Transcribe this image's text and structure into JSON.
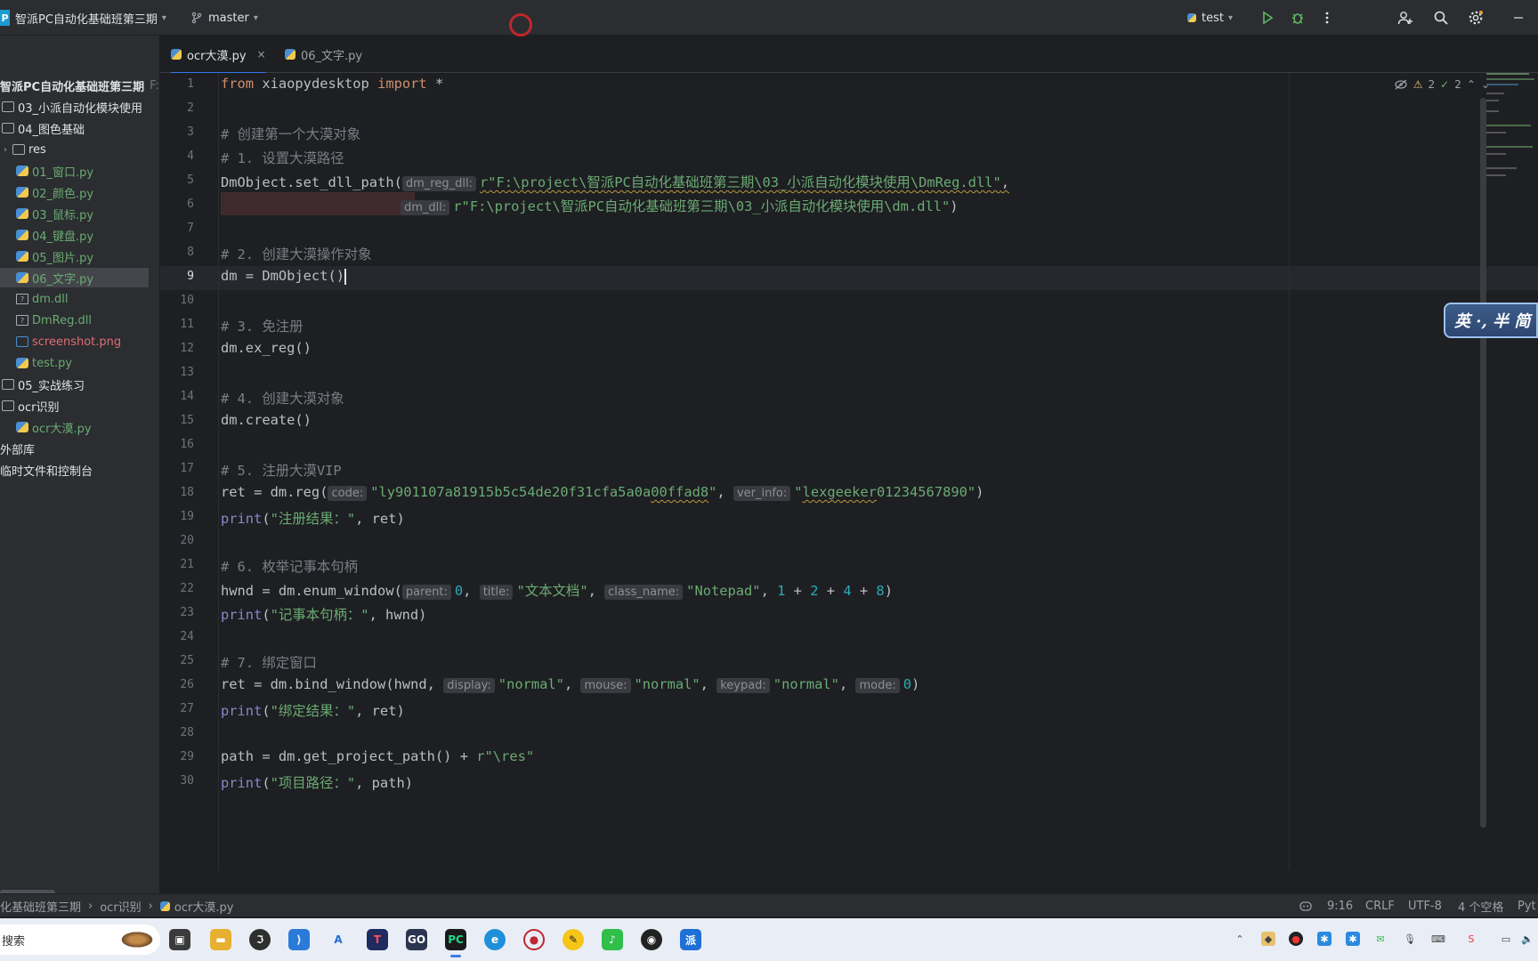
{
  "titlebar": {
    "app_badge": "P",
    "project": "智派PC自动化基础班第三期",
    "branch": "master",
    "run_config": "test"
  },
  "sidebar": {
    "items": [
      {
        "label": "智派PC自动化基础班第三期",
        "suffix": "F:\\",
        "kind": "root"
      },
      {
        "label": "03_小派自动化模块使用",
        "kind": "folder"
      },
      {
        "label": "04_图色基础",
        "kind": "folder"
      },
      {
        "label": "res",
        "kind": "folder-sub"
      },
      {
        "label": "01_窗口.py",
        "kind": "py"
      },
      {
        "label": "02_颜色.py",
        "kind": "py"
      },
      {
        "label": "03_鼠标.py",
        "kind": "py"
      },
      {
        "label": "04_键盘.py",
        "kind": "py"
      },
      {
        "label": "05_图片.py",
        "kind": "py"
      },
      {
        "label": "06_文字.py",
        "kind": "py-selected"
      },
      {
        "label": "dm.dll",
        "kind": "dll"
      },
      {
        "label": "DmReg.dll",
        "kind": "dll"
      },
      {
        "label": "screenshot.png",
        "kind": "png"
      },
      {
        "label": "test.py",
        "kind": "py"
      },
      {
        "label": "05_实战练习",
        "kind": "folder"
      },
      {
        "label": "ocr识别",
        "kind": "folder"
      },
      {
        "label": "ocr大漠.py",
        "kind": "py"
      },
      {
        "label": "外部库",
        "kind": "lib"
      },
      {
        "label": "临时文件和控制台",
        "kind": "lib"
      }
    ]
  },
  "tabs": [
    {
      "label": "ocr大漠.py",
      "active": true,
      "close": "×"
    },
    {
      "label": "06_文字.py",
      "active": false
    }
  ],
  "inspections": {
    "warnings": "2",
    "ok": "2"
  },
  "code": {
    "line_numbers": [
      "1",
      "2",
      "3",
      "4",
      "5",
      "6",
      "7",
      "8",
      "9",
      "10",
      "11",
      "12",
      "13",
      "14",
      "15",
      "16",
      "17",
      "18",
      "19",
      "20",
      "21",
      "22",
      "23",
      "24",
      "25",
      "26",
      "27",
      "28",
      "29",
      "30"
    ],
    "current_line": 9,
    "l1_kw1": "from",
    "l1_mod": " xiaopydesktop ",
    "l1_kw2": "import",
    "l1_rest": " *",
    "l3": "# 创建第一个大漠对象",
    "l4": "# 1. 设置大漠路径",
    "l5_code": "DmObject.set_dll_path(",
    "l5_hint": "dm_reg_dll:",
    "l5_str": "r\"F:\\project\\智派PC自动化基础班第三期\\03_小派自动化模块使用\\DmReg.dll\"",
    "l5_tail": ",",
    "l6_hint": "dm_dll:",
    "l6_str": "r\"F:\\project\\智派PC自动化基础班第三期\\03_小派自动化模块使用\\dm.dll\"",
    "l6_tail": ")",
    "l8": "# 2. 创建大漠操作对象",
    "l9": "dm = DmObject()",
    "l11": "# 3. 免注册",
    "l12": "dm.ex_reg()",
    "l14": "# 4. 创建大漠对象",
    "l15": "dm.create()",
    "l17": "# 5. 注册大漠VIP",
    "l18_code": "ret = dm.reg(",
    "l18_hint1": "code:",
    "l18_str1a": "\"ly901107a81915b5c54de20f31cfa5a0a",
    "l18_str1b": "00ffad8",
    "l18_str1c": "\"",
    "l18_sep": ", ",
    "l18_hint2": "ver_info:",
    "l18_str2a": "\"",
    "l18_str2b": "lexgeeker",
    "l18_str2c": "01234567890\"",
    "l18_tail": ")",
    "l19_fn": "print",
    "l19_p": "(",
    "l19_str": "\"注册结果：\"",
    "l19_rest": ", ret)",
    "l21": "# 6. 枚举记事本句柄",
    "l22_code": "hwnd = dm.enum_window(",
    "l22_hint1": "parent:",
    "l22_v1": "0",
    "l22_sep1": ", ",
    "l22_hint2": "title:",
    "l22_v2": "\"文本文档\"",
    "l22_sep2": ", ",
    "l22_hint3": "class_name:",
    "l22_v3": "\"Notepad\"",
    "l22_sep3": ", ",
    "l22_n1": "1",
    "l22_op1": " + ",
    "l22_n2": "2",
    "l22_op2": " + ",
    "l22_n3": "4",
    "l22_op3": " + ",
    "l22_n4": "8",
    "l22_tail": ")",
    "l23_fn": "print",
    "l23_p": "(",
    "l23_str": "\"记事本句柄：\"",
    "l23_rest": ", hwnd)",
    "l25": "# 7. 绑定窗口",
    "l26_code": "ret = dm.bind_window(hwnd, ",
    "l26_hint1": "display:",
    "l26_v1": "\"normal\"",
    "l26_sep1": ", ",
    "l26_hint2": "mouse:",
    "l26_v2": "\"normal\"",
    "l26_sep2": ", ",
    "l26_hint3": "keypad:",
    "l26_v3": "\"normal\"",
    "l26_sep3": ", ",
    "l26_hint4": "mode:",
    "l26_v4": "0",
    "l26_tail": ")",
    "l27_fn": "print",
    "l27_p": "(",
    "l27_str": "\"绑定结果：\"",
    "l27_rest": ", ret)",
    "l29_code": "path = dm.get_project_path() + ",
    "l29_str": "r\"\\res\"",
    "l30_fn": "print",
    "l30_p": "(",
    "l30_str": "\"项目路径：\"",
    "l30_rest": ", path)"
  },
  "ime_label": "英 ·, 半 简",
  "statusbar": {
    "crumb1": "化基础班第三期",
    "crumb2": "ocr识别",
    "crumb3": "ocr大漠.py",
    "position": "9:16",
    "line_sep": "CRLF",
    "encoding": "UTF-8",
    "indent": "4 个空格",
    "interpreter": "Pyt"
  },
  "taskbar": {
    "search_placeholder": "搜索"
  },
  "colors": {
    "accent": "#3574f0",
    "string": "#6aab73",
    "keyword": "#cf8e6d",
    "comment": "#7a7e85",
    "number": "#2aacb8"
  }
}
